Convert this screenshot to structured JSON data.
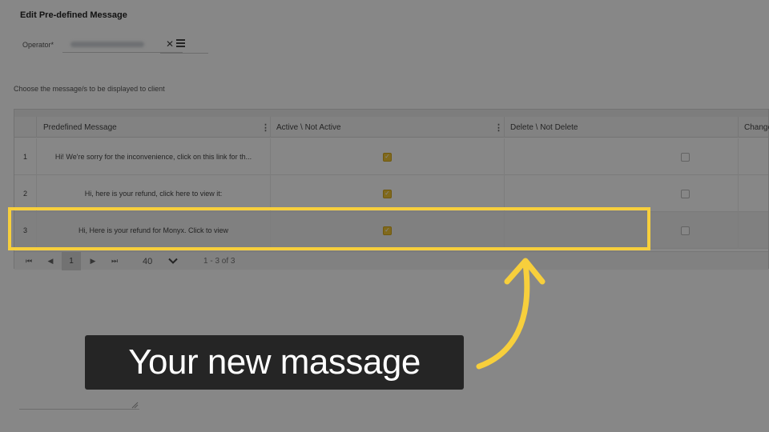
{
  "page": {
    "title": "Edit Pre-defined Message",
    "operator_label": "Operator*",
    "choose_text": "Choose the message/s to be displayed to client"
  },
  "grid": {
    "columns": [
      "",
      "Predefined Message",
      "Active \\ Not Active",
      "Delete \\ Not Delete",
      "Change"
    ],
    "rows": [
      {
        "num": "1",
        "message": "Hi! We're sorry for the inconvenience, click on this link for th...",
        "active": true,
        "delete": false
      },
      {
        "num": "2",
        "message": "Hi, here is your refund, click here to view it:",
        "active": true,
        "delete": false
      },
      {
        "num": "3",
        "message": "Hi, Here is your refund for Monyx. Click to view",
        "active": true,
        "delete": false
      }
    ],
    "pager": {
      "first": "⏮",
      "prev": "◀",
      "page": "1",
      "next": "▶",
      "last": "⏭",
      "page_size": "40",
      "info": "1 - 3 of 3"
    }
  },
  "annotation": {
    "callout_text": "Your new massage",
    "accent_color": "#f7cf3c"
  },
  "icons": {
    "clear": "close-icon",
    "list": "list-icon",
    "column_menu": "kebab-icon",
    "checkbox_checked": "checkmark-icon"
  }
}
